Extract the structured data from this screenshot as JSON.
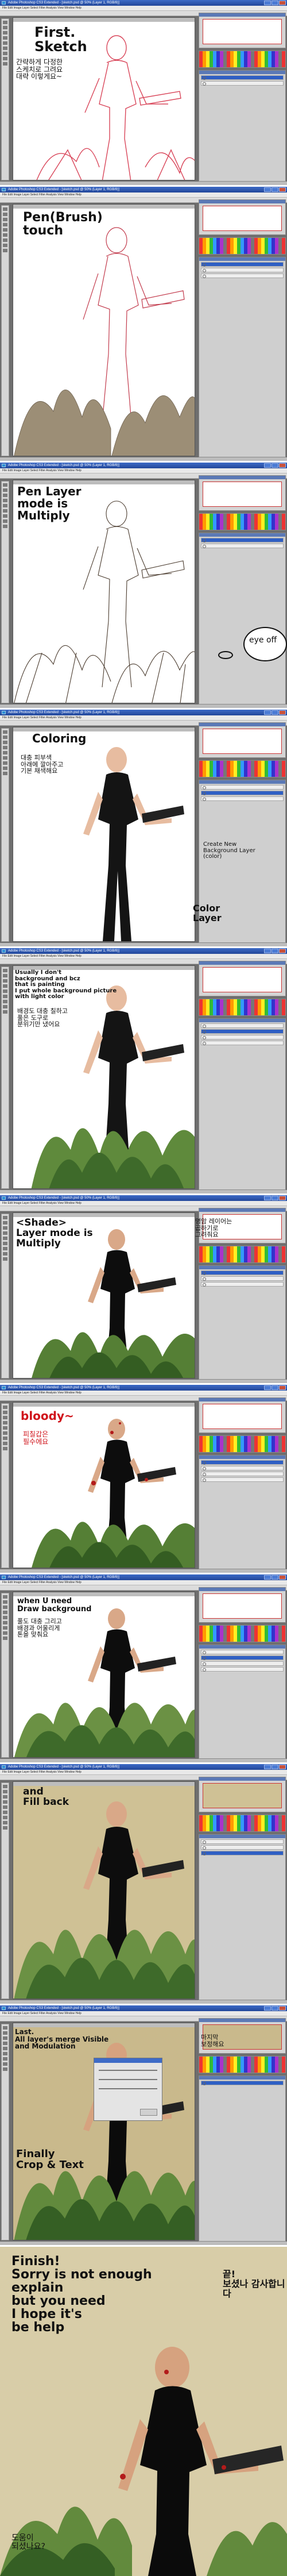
{
  "app": {
    "window_title": "Adobe Photoshop CS3 Extended - [sketch.psd @ 50% (Layer 1, RGB/8)]",
    "menu": "File  Edit  Image  Layer  Select  Filter  Analysis  View  Window  Help"
  },
  "colors": {
    "sketch": "#d9465a",
    "skin": "#e7bca0",
    "shirt": "#141414",
    "plant": "#5f8a3c",
    "plant_dark": "#3e6a2a",
    "bg_tan": "#cfc195",
    "blood": "#b31b1b"
  },
  "steps": [
    {
      "id": "sketch",
      "notes": [
        {
          "text": "First.\nSketch",
          "color": "#111111"
        },
        {
          "text": "간략하게 다정한\n스케치로 그려요\n대략 이렇게요~",
          "color": "#111111"
        }
      ]
    },
    {
      "id": "pen",
      "notes": [
        {
          "text": "Pen(Brush)\ntouch",
          "color": "#111111"
        }
      ]
    },
    {
      "id": "multiply",
      "notes": [
        {
          "text": "Pen Layer\nmode is\nMultiply",
          "color": "#111111"
        },
        {
          "text": "eye off",
          "color": "#111111"
        }
      ]
    },
    {
      "id": "coloring",
      "notes": [
        {
          "text": "Coloring",
          "color": "#111111"
        },
        {
          "text": "대충 피부색\n아래에 깔아주고\n기본 채색해요",
          "color": "#111111"
        },
        {
          "text": "Create New\nBackground Layer\n(color)",
          "color": "#111111"
        },
        {
          "text": "Color\nLayer",
          "color": "#111111"
        }
      ]
    },
    {
      "id": "background",
      "notes": [
        {
          "text": "Usually I don't\nbackground and bcz\nthat is painting\nI put whole background picture\nwith light color",
          "color": "#111111"
        },
        {
          "text": "배경도 대충 칠하고\n풀은 도구로\n분위기만 냈어요",
          "color": "#111111"
        }
      ]
    },
    {
      "id": "shade",
      "notes": [
        {
          "text": "<Shade>\nLayer mode is\nMultiply",
          "color": "#111111"
        },
        {
          "text": "명암 레이어는\n곱하기로\n그려줘요",
          "color": "#111111"
        }
      ]
    },
    {
      "id": "bloody",
      "notes": [
        {
          "text": "bloody~",
          "color": "#d0141b"
        },
        {
          "text": "피칠갑은\n필수에요",
          "color": "#d0141b"
        }
      ]
    },
    {
      "id": "draw-background",
      "notes": [
        {
          "text": "when U need\nDraw background",
          "color": "#111111"
        },
        {
          "text": "풀도 대충 그리고\n배경과 어울리게\n톤을 맞춰요",
          "color": "#111111"
        }
      ]
    },
    {
      "id": "fill-back",
      "notes": [
        {
          "text": "and\nFill back",
          "color": "#111111"
        }
      ]
    },
    {
      "id": "merge",
      "notes": [
        {
          "text": "Last.\nAll layer's merge Visible\nand Modulation",
          "color": "#111111"
        },
        {
          "text": "Finally\nCrop & Text",
          "color": "#111111"
        },
        {
          "text": "마지막\n보정해요",
          "color": "#111111"
        }
      ]
    },
    {
      "id": "finish",
      "notes": [
        {
          "text": "Finish!\nSorry is not enough\nexplain\nbut you need\nI hope it's\nbe help",
          "color": "#111111"
        },
        {
          "text": "끝!\n보셨나 감사합니다",
          "color": "#111111"
        },
        {
          "text": "도움이\n되셨나요?",
          "color": "#111111"
        }
      ]
    }
  ]
}
